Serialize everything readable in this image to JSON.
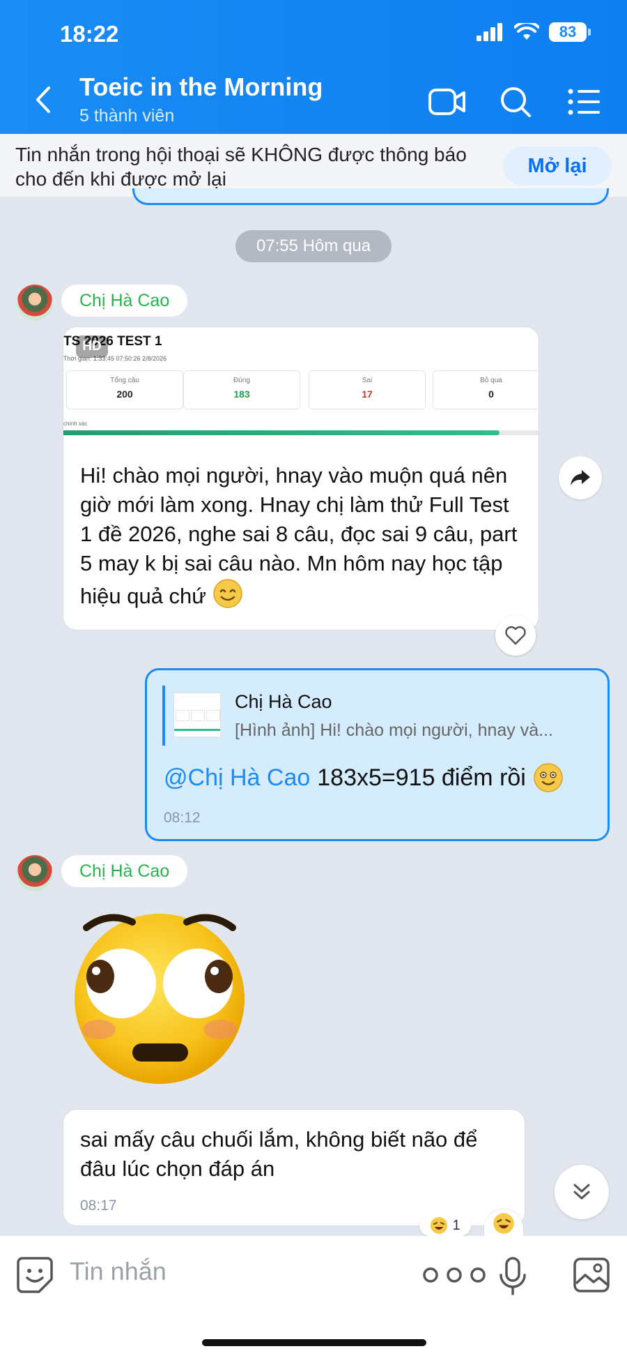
{
  "status_bar": {
    "time": "18:22",
    "battery": "83"
  },
  "header": {
    "title": "Toeic in the Morning",
    "subtitle": "5 thành viên"
  },
  "notice": {
    "text": "Tin nhắn trong hội thoại sẽ KHÔNG được thông báo cho đến khi được mở lại",
    "button": "Mở lại"
  },
  "divider_time": "07:55 Hôm qua",
  "messages": {
    "m1": {
      "sender": "Chị Hà Cao",
      "image": {
        "badge": "HD",
        "title": "TS 2026 TEST 1",
        "meta": "Thời gian: 1:33:45     07:50:26 2/8/2026",
        "stats": [
          {
            "label": "Tổng câu",
            "value": "200",
            "color": "#222222"
          },
          {
            "label": "Đúng",
            "value": "183",
            "color": "#1f9f4f"
          },
          {
            "label": "Sai",
            "value": "17",
            "color": "#d0342c"
          },
          {
            "label": "Bỏ qua",
            "value": "0",
            "color": "#222222"
          }
        ],
        "accuracy_label": "chính xác",
        "progress": 0.915
      },
      "text": "Hi! chào mọi người, hnay vào muộn quá nên giờ mới làm xong. Hnay chị làm thử Full Test 1 đề 2026, nghe sai 8 câu, đọc sai 9 câu, part 5 may k bị sai câu nào. Mn hôm nay học tập hiệu quả chứ"
    },
    "m2": {
      "quote_name": "Chị Hà Cao",
      "quote_text": "[Hình ảnh] Hi! chào mọi người, hnay và...",
      "mention": "@Chị Hà Cao",
      "text": "183x5=915 điểm rồi",
      "time": "08:12"
    },
    "m3": {
      "sender": "Chị Hà Cao"
    },
    "m4": {
      "text": "sai mấy câu chuối lắm, không biết não để đâu lúc chọn đáp án",
      "time": "08:17",
      "reaction_count": "1"
    }
  },
  "input": {
    "placeholder": "Tin nhắn"
  },
  "colors": {
    "brand": "#0e7ff0",
    "sender": "#2ab24e",
    "mine_bubble": "#d5ecfd"
  }
}
